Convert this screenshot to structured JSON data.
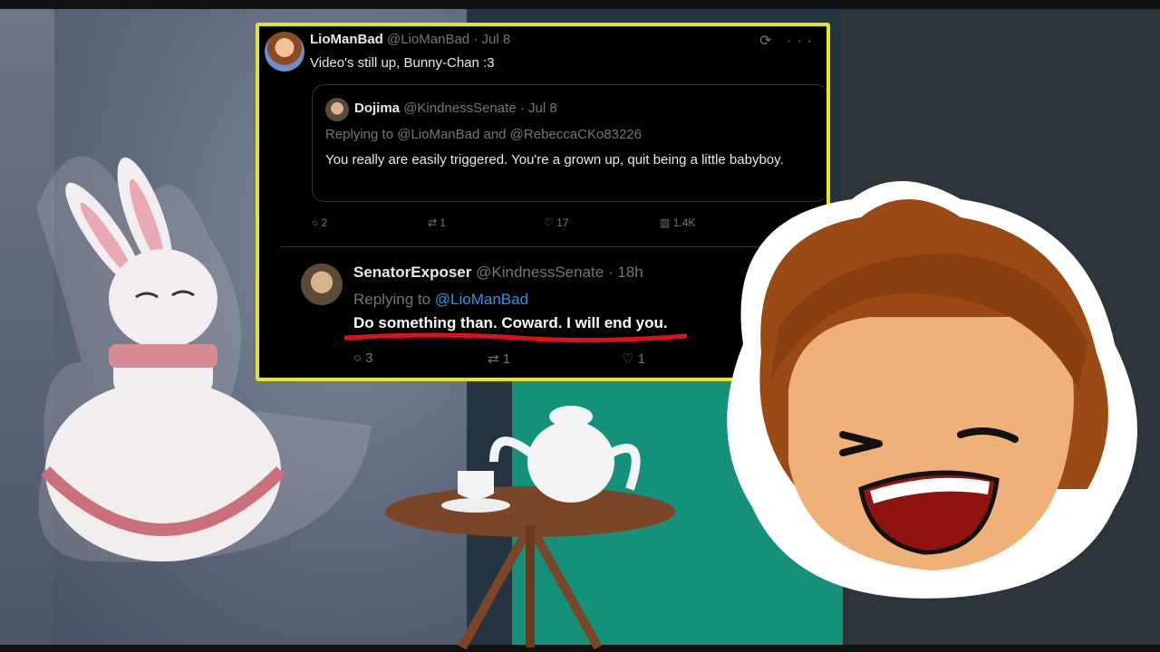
{
  "tweet": {
    "author": {
      "name": "LioManBad",
      "handle": "@LioManBad",
      "time": "· Jul 8"
    },
    "text": "Video's still up, Bunny-Chan :3",
    "top_icons": "⟳ ···",
    "quote": {
      "author": {
        "name": "Dojima",
        "handle": "@KindnessSenate",
        "time": "· Jul 8"
      },
      "replying_to": "Replying to @LioManBad and @RebeccaCKo83226",
      "text": "You really are easily triggered. You're a grown up, quit being a little babyboy."
    },
    "actions": {
      "replies": "2",
      "retweets": "1",
      "likes": "17",
      "views": "1.4K",
      "reply_icon": "○",
      "retweet_icon": "⇄",
      "like_icon": "♡",
      "views_icon": "▥"
    }
  },
  "reply": {
    "author": {
      "name": "SenatorExposer",
      "handle": "@KindnessSenate",
      "time": "· 18h"
    },
    "replying_prefix": "Replying to",
    "replying_handle": "@LioManBad",
    "text": "Do something than. Coward. I will end you.",
    "actions": {
      "replies": "3",
      "retweets": "1",
      "likes": "1"
    }
  },
  "colors": {
    "highlight_border": "#e6e51e",
    "underline": "#e0101a",
    "link": "#1d9bf0"
  }
}
